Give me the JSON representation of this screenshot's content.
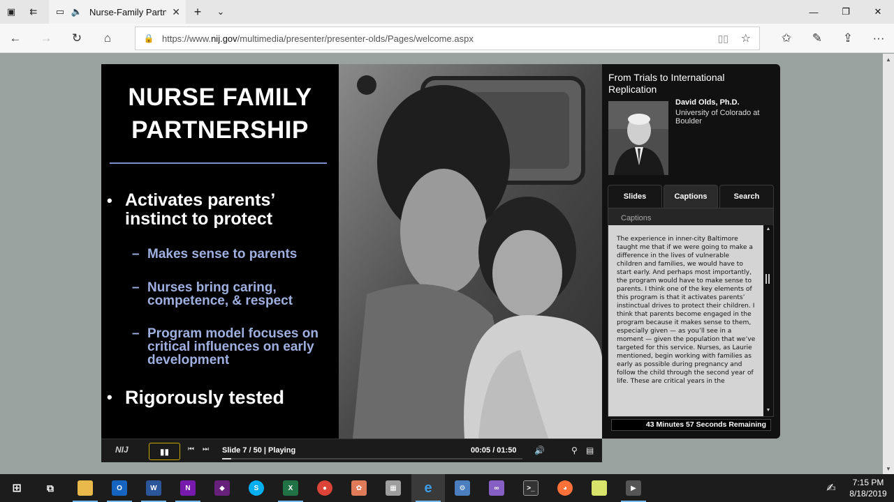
{
  "browser": {
    "tab_title": "Nurse-Family Partne",
    "url_prefix": "https://www.",
    "url_domain": "nij.gov",
    "url_path": "/multimedia/presenter/presenter-olds/Pages/welcome.aspx"
  },
  "slide": {
    "title_line1": "NURSE FAMILY",
    "title_line2": "PARTNERSHIP",
    "bullet1_line1": "Activates parents’",
    "bullet1_line2": "instinct to protect",
    "sub1": "Makes sense to parents",
    "sub2_line1": "Nurses bring caring,",
    "sub2_line2": "competence, & respect",
    "sub3_line1": "Program model focuses on",
    "sub3_line2": "critical influences on early",
    "sub3_line3": "development",
    "bullet2": "Rigorously tested",
    "bullet_mark": "•",
    "dash_mark": "–"
  },
  "player": {
    "logo": "NIJ",
    "status": "Slide 7 / 50 | Playing",
    "time": "00:05 / 01:50",
    "progress": 0.03
  },
  "sidebar": {
    "title": "From Trials to International Replication",
    "speaker_name": "David Olds, Ph.D.",
    "speaker_affiliation": "University of Colorado at Boulder",
    "tabs": [
      "Slides",
      "Captions",
      "Search"
    ],
    "active_tab": "Captions",
    "captions_label": "Captions",
    "caption_text": "The experience in inner-city Baltimore taught me that if we were going to make a difference in the lives of vulnerable children and families, we would have to start early. And perhaps most importantly, the program would have to make sense to parents. I think one of the key elements of this program is that it activates parents’ instinctual drives to protect their children. I think that parents become engaged in the program because it makes sense to them, especially given — as you’ll see in a moment — given the population that we’ve targeted for this service. Nurses, as Laurie mentioned, begin working with families as early as possible during pregnancy and follow the child through the second year of life. These are critical years in the",
    "remaining": "43 Minutes 57 Seconds Remaining"
  },
  "taskbar": {
    "time": "7:15 PM",
    "date": "8/18/2019"
  },
  "colors": {
    "slide_accent": "#9fb0e0",
    "play_border": "#c9a800",
    "page_bg": "#9aa29f"
  }
}
